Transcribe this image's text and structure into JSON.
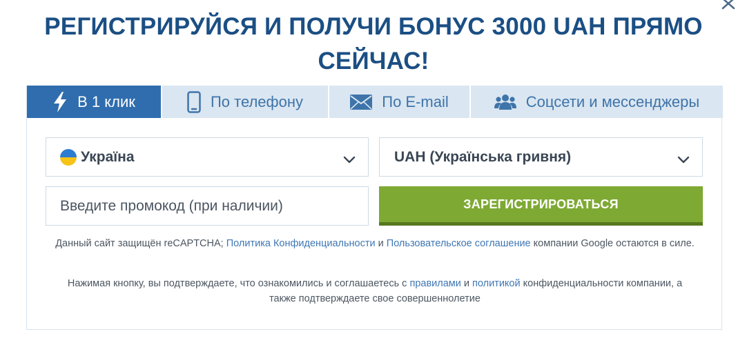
{
  "page": {
    "title": "РЕГИСТРИРУЙСЯ И ПОЛУЧИ БОНУС 3000 UAH ПРЯМО СЕЙЧАС!",
    "close_icon": "close-icon"
  },
  "tabs": [
    {
      "label": "В 1 клик",
      "icon": "lightning-icon",
      "active": true
    },
    {
      "label": "По телефону",
      "icon": "phone-icon",
      "active": false
    },
    {
      "label": "По E-mail",
      "icon": "envelope-icon",
      "active": false
    },
    {
      "label": "Соцсети и мессенджеры",
      "icon": "users-icon",
      "active": false
    }
  ],
  "form": {
    "country": {
      "value": "Україна",
      "icon": "ukraine-flag-icon"
    },
    "currency": {
      "value": "UAH (Українська гривня)"
    },
    "promo": {
      "placeholder": "Введите промокод (при наличии)",
      "value": ""
    },
    "submit_label": "ЗАРЕГИСТРИРОВАТЬСЯ"
  },
  "legal": {
    "recaptcha": {
      "prefix": "Данный сайт защищён reCAPTCHA;",
      "privacy_link": "Политика Конфиденциальности",
      "and": "и",
      "terms_link": "Пользовательское соглашение",
      "suffix": "компании Google остаются в силе."
    },
    "consent": {
      "prefix": "Нажимая кнопку, вы подтверждаете, что ознакомились и соглашаетесь с",
      "rules_link": "правилами",
      "and": "и",
      "policy_link": "политикой",
      "suffix": "конфиденциальности компании, а также подтверждаете свое совершеннолетие"
    }
  },
  "colors": {
    "title": "#1b4f84",
    "tab_active_bg": "#2f6dae",
    "tab_bg": "#dae6f1",
    "tab_text": "#3e74a9",
    "submit_bg": "#7ea933",
    "link": "#3f77b4"
  }
}
